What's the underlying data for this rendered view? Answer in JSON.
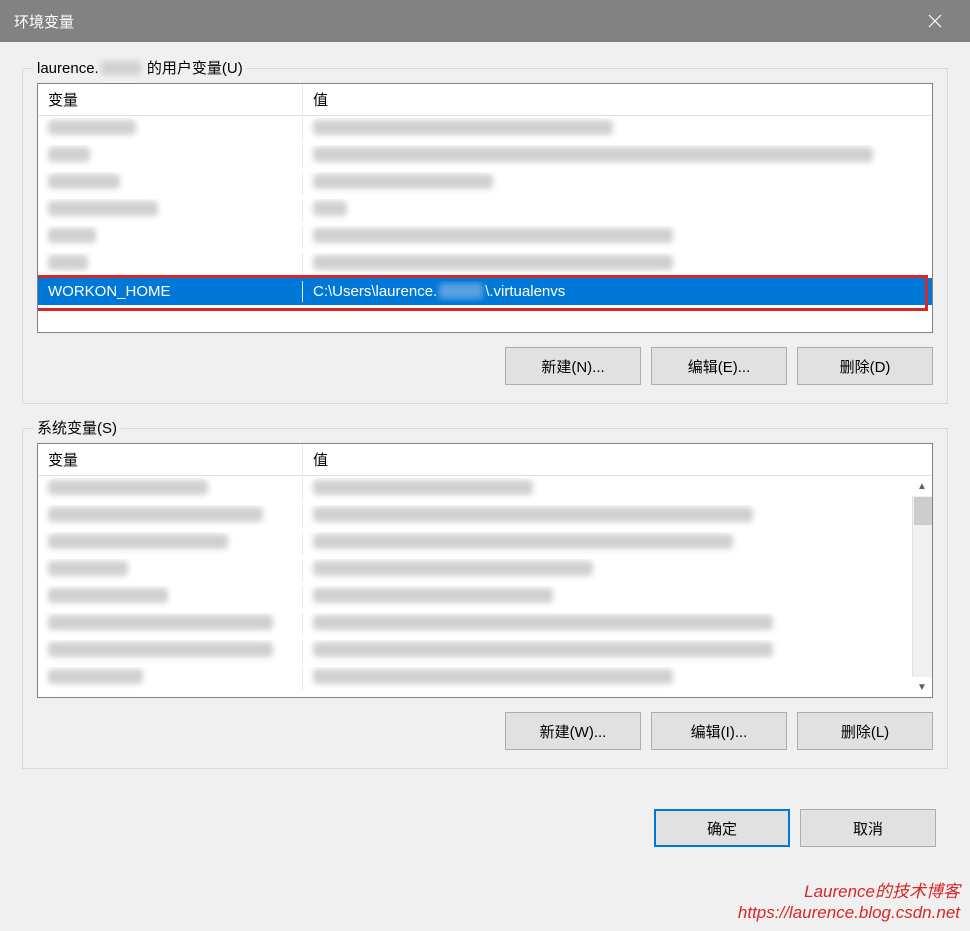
{
  "titlebar": {
    "title": "环境变量"
  },
  "user_group": {
    "legend_prefix": "laurence.",
    "legend_suffix": " 的用户变量(U)",
    "columns": {
      "variable": "变量",
      "value": "值"
    },
    "selected_row": {
      "variable": "WORKON_HOME",
      "value_prefix": "C:\\Users\\laurence.",
      "value_suffix": "\\.virtualenvs"
    },
    "buttons": {
      "new": "新建(N)...",
      "edit": "编辑(E)...",
      "delete": "删除(D)"
    }
  },
  "system_group": {
    "legend": "系统变量(S)",
    "columns": {
      "variable": "变量",
      "value": "值"
    },
    "buttons": {
      "new": "新建(W)...",
      "edit": "编辑(I)...",
      "delete": "删除(L)"
    }
  },
  "dialog_buttons": {
    "ok": "确定",
    "cancel": "取消"
  },
  "watermark": {
    "line1": "Laurence的技术博客",
    "line2": "https://laurence.blog.csdn.net"
  }
}
